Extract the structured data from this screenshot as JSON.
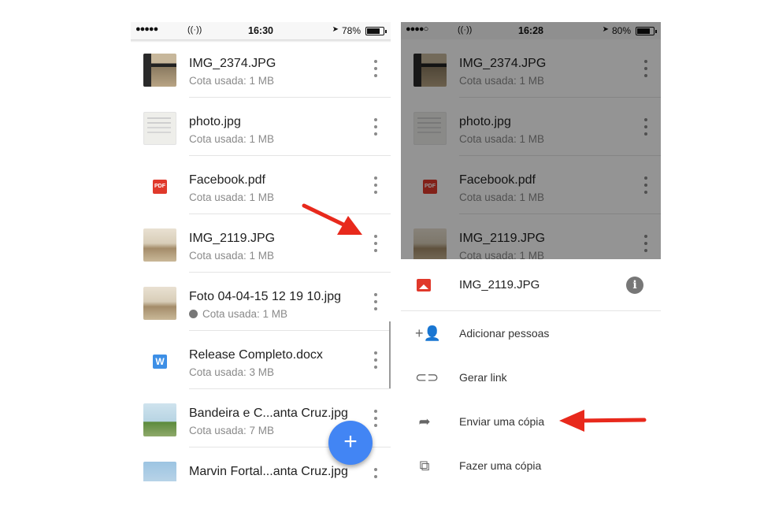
{
  "left": {
    "status": {
      "time": "16:30",
      "battery": "78%",
      "battery_level": 0.78
    },
    "files": [
      {
        "name": "IMG_2374.JPG",
        "sub": "Cota usada: 1 MB",
        "thumb": "photo-a",
        "shared": false
      },
      {
        "name": "photo.jpg",
        "sub": "Cota usada: 1 MB",
        "thumb": "photo-b",
        "shared": false
      },
      {
        "name": "Facebook.pdf",
        "sub": "Cota usada: 1 MB",
        "thumb": "pdf",
        "icon_text": "PDF",
        "shared": false
      },
      {
        "name": "IMG_2119.JPG",
        "sub": "Cota usada: 1 MB",
        "thumb": "photo-c",
        "shared": false
      },
      {
        "name": "Foto 04-04-15 12 19 10.jpg",
        "sub": "Cota usada: 1 MB",
        "thumb": "photo-c",
        "shared": true
      },
      {
        "name": "Release Completo.docx",
        "sub": "Cota usada: 3 MB",
        "thumb": "doc",
        "icon_text": "W",
        "shared": false
      },
      {
        "name": "Bandeira e C...anta Cruz.jpg",
        "sub": "Cota usada: 7 MB",
        "thumb": "photo-d",
        "shared": false
      },
      {
        "name": "Marvin Fortal...anta Cruz.jpg",
        "sub": "",
        "thumb": "photo-e",
        "shared": false
      }
    ],
    "fab_label": "+"
  },
  "right": {
    "status": {
      "time": "16:28",
      "battery": "80%",
      "battery_level": 0.8
    },
    "files": [
      {
        "name": "IMG_2374.JPG",
        "sub": "Cota usada: 1 MB",
        "thumb": "photo-a"
      },
      {
        "name": "photo.jpg",
        "sub": "Cota usada: 1 MB",
        "thumb": "photo-b"
      },
      {
        "name": "Facebook.pdf",
        "sub": "Cota usada: 1 MB",
        "thumb": "pdf",
        "icon_text": "PDF"
      },
      {
        "name": "IMG_2119.JPG",
        "sub": "Cota usada: 1 MB",
        "thumb": "photo-c"
      }
    ],
    "sheet": {
      "title": "IMG_2119.JPG",
      "info_icon": "i",
      "actions": [
        {
          "label": "Adicionar pessoas",
          "icon": "add-person-icon",
          "glyph": "+👤"
        },
        {
          "label": "Gerar link",
          "icon": "link-icon",
          "glyph": "⊂⊃"
        },
        {
          "label": "Enviar uma cópia",
          "icon": "share-arrow-icon",
          "glyph": "➦"
        },
        {
          "label": "Fazer uma cópia",
          "icon": "copy-icon",
          "glyph": "⧉"
        }
      ]
    }
  },
  "colors": {
    "accent": "#4285f4",
    "arrow": "#e8291c",
    "pdf": "#e0392b",
    "doc": "#3d8fe6"
  }
}
